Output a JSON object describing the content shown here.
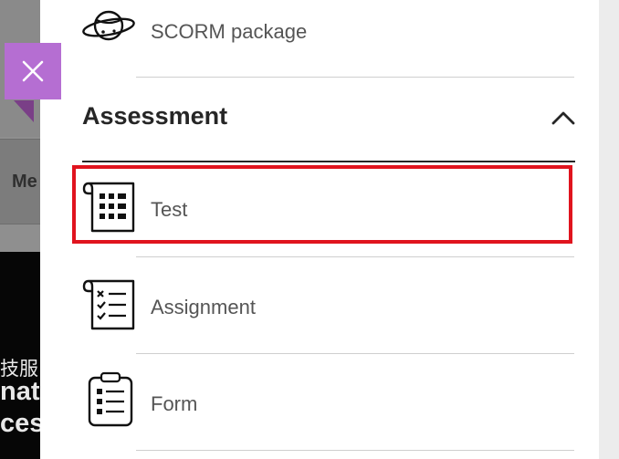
{
  "background": {
    "menu_fragment": "Me",
    "cjk_fragment": "技服",
    "text_line1": "nat",
    "text_line2": "ces"
  },
  "close_button": {
    "icon": "close-icon"
  },
  "panel": {
    "items_top": [
      {
        "label": "SCORM package",
        "icon": "scorm-globe-icon"
      }
    ],
    "section": {
      "title": "Assessment",
      "toggle_icon": "chevron-up-icon"
    },
    "assessment_items": [
      {
        "label": "Test",
        "icon": "test-grid-icon",
        "highlighted": true
      },
      {
        "label": "Assignment",
        "icon": "assignment-checklist-icon",
        "highlighted": false
      },
      {
        "label": "Form",
        "icon": "form-clipboard-icon",
        "highlighted": false
      }
    ]
  },
  "colors": {
    "close_bg": "#b56ed2",
    "highlight": "#e0141e"
  }
}
